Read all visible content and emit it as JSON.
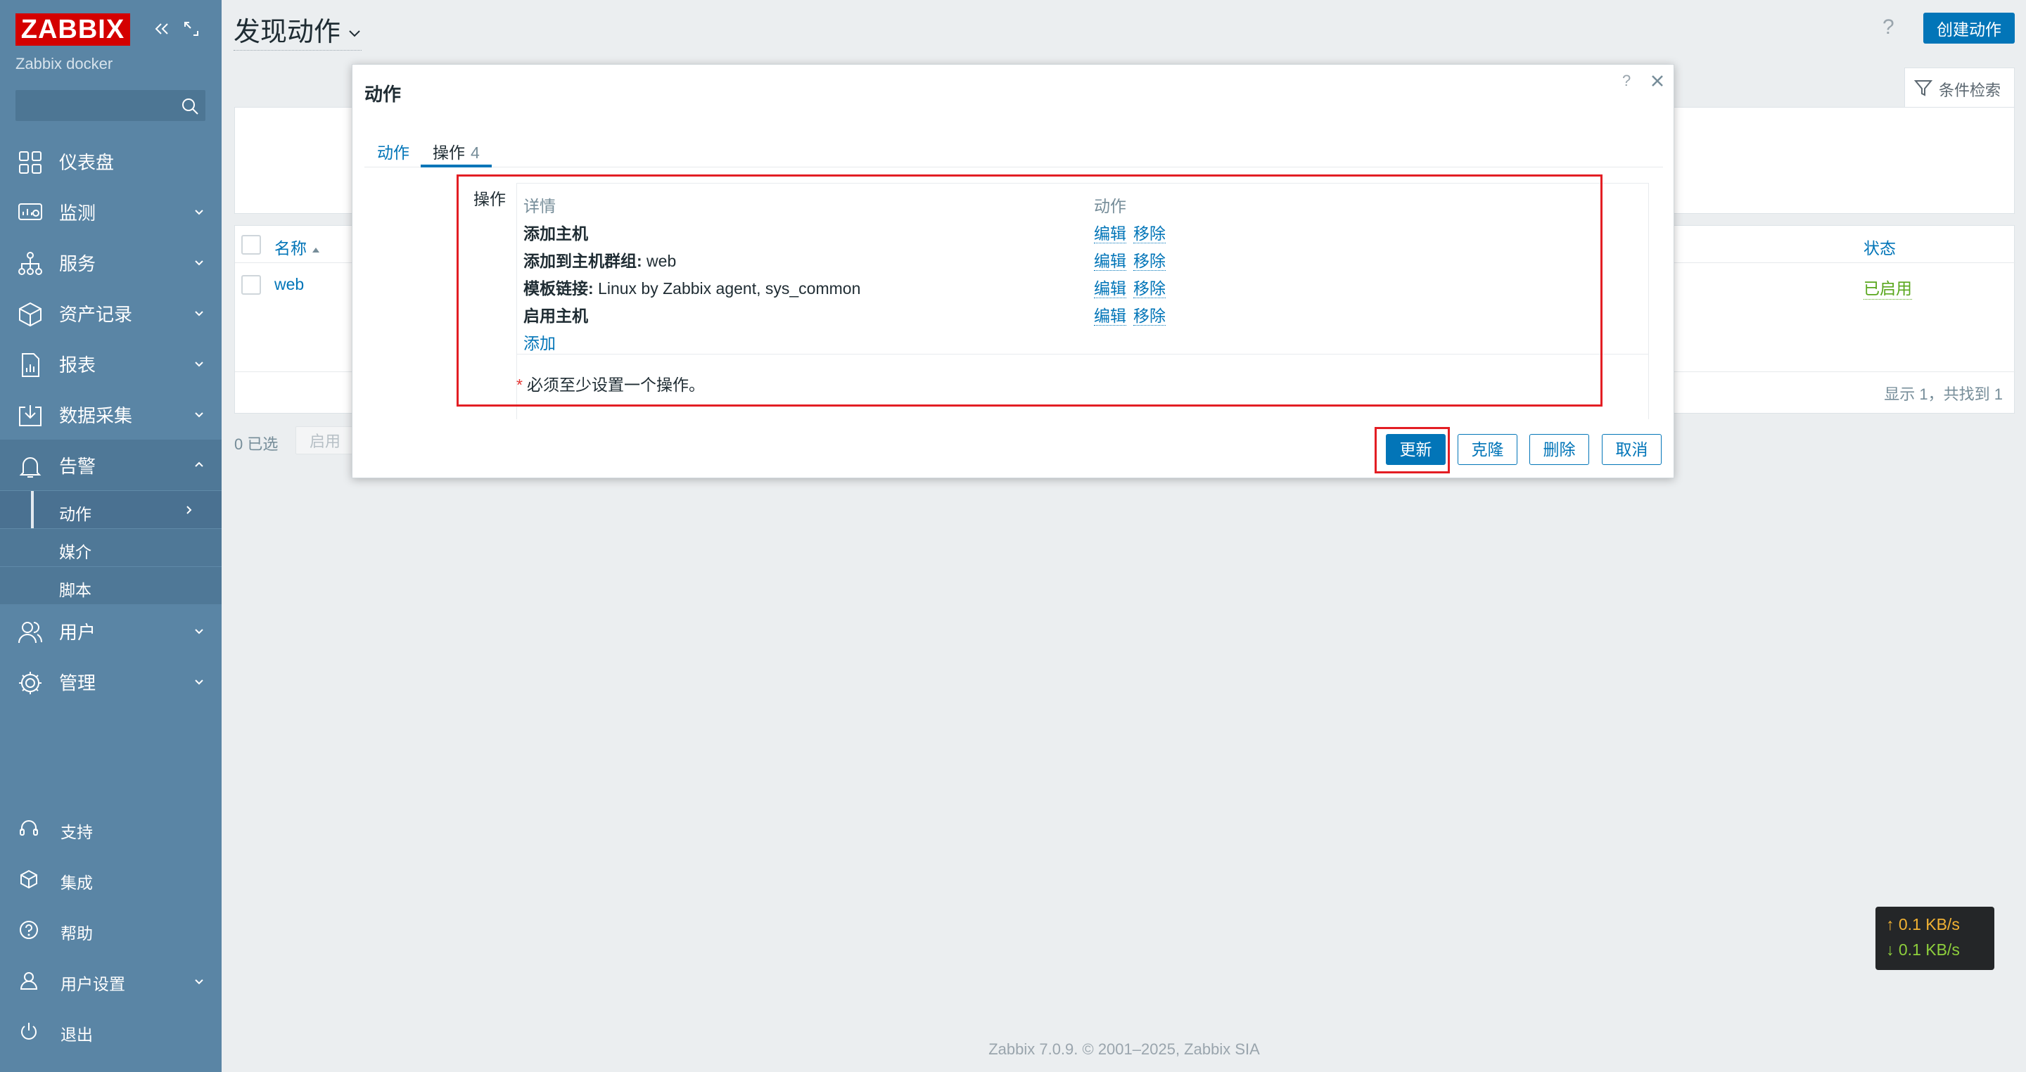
{
  "sidebar": {
    "logo": "ZABBIX",
    "subtitle": "Zabbix docker",
    "search_placeholder": "",
    "nav": [
      {
        "label": "仪表盘",
        "icon": "dashboard-icon",
        "chevron": false
      },
      {
        "label": "监测",
        "icon": "monitoring-icon",
        "chevron": true
      },
      {
        "label": "服务",
        "icon": "services-icon",
        "chevron": true
      },
      {
        "label": "资产记录",
        "icon": "inventory-icon",
        "chevron": true
      },
      {
        "label": "报表",
        "icon": "reports-icon",
        "chevron": true
      },
      {
        "label": "数据采集",
        "icon": "data-collection-icon",
        "chevron": true
      },
      {
        "label": "告警",
        "icon": "bell-icon",
        "chevron": true,
        "expanded": true
      }
    ],
    "alerts_sub": [
      {
        "label": "动作",
        "current": true
      },
      {
        "label": "媒介"
      },
      {
        "label": "脚本"
      }
    ],
    "nav_after": [
      {
        "label": "用户",
        "icon": "users-icon"
      },
      {
        "label": "管理",
        "icon": "gear-icon"
      }
    ],
    "bottom": [
      {
        "label": "支持",
        "icon": "headset-icon",
        "chevron": false
      },
      {
        "label": "集成",
        "icon": "integrations-icon",
        "chevron": false
      },
      {
        "label": "帮助",
        "icon": "help-icon",
        "chevron": false
      },
      {
        "label": "用户设置",
        "icon": "user-settings-icon",
        "chevron": true
      },
      {
        "label": "退出",
        "icon": "power-icon",
        "chevron": false
      }
    ]
  },
  "header": {
    "title": "发现动作",
    "help": "?",
    "create_button": "创建动作",
    "filter_tab": "条件检索"
  },
  "list": {
    "col_name": "名称",
    "col_status": "状态",
    "rows": [
      {
        "name": "web",
        "status": "已启用"
      }
    ],
    "summary": "显示 1，共找到 1",
    "selected": "0 已选",
    "enable_button": "启用"
  },
  "modal": {
    "title": "动作",
    "help": "?",
    "tabs": [
      {
        "label": "动作"
      },
      {
        "label": "操作",
        "count": "4"
      }
    ],
    "ops_label": "操作",
    "col_details": "详情",
    "col_actions": "动作",
    "operations": [
      {
        "bold": "添加主机",
        "rest": ""
      },
      {
        "bold": "添加到主机群组:",
        "rest": " web"
      },
      {
        "bold": "模板链接:",
        "rest": " Linux by Zabbix agent, sys_common"
      },
      {
        "bold": "启用主机",
        "rest": ""
      }
    ],
    "edit_label": "编辑",
    "remove_label": "移除",
    "add_link": "添加",
    "required_star": "*",
    "required_note": "必须至少设置一个操作。",
    "buttons": {
      "update": "更新",
      "clone": "克隆",
      "delete": "删除",
      "cancel": "取消"
    }
  },
  "speed": {
    "up": "↑ 0.1 KB/s",
    "down": "↓ 0.1 KB/s"
  },
  "footer": "Zabbix 7.0.9. © 2001–2025, Zabbix SIA"
}
